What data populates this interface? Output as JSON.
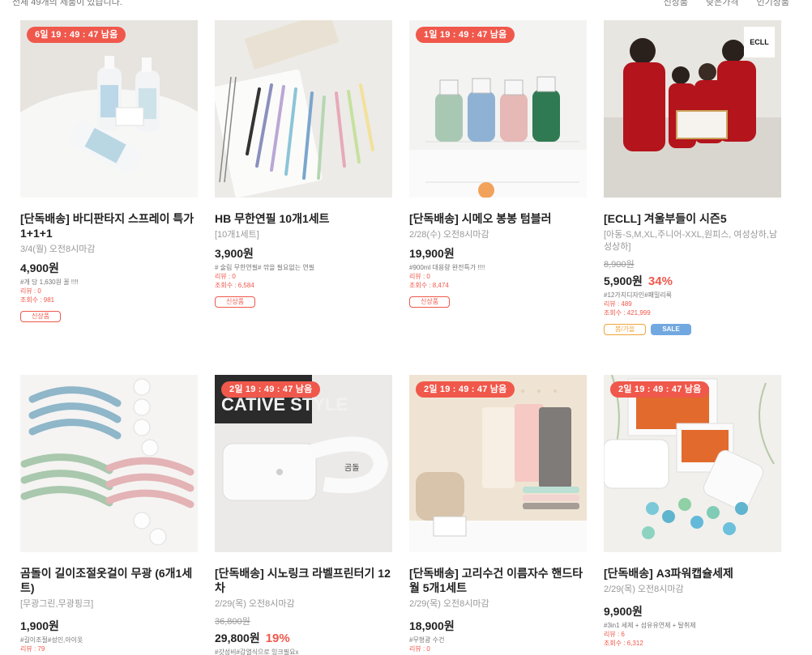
{
  "header": {
    "total_text": "전체 49개의 제품이 있습니다.",
    "sort_options": [
      "신상품",
      "낮은가격",
      "인기상품"
    ]
  },
  "products": [
    {
      "timer": "6일 19 : 49 : 47 남음",
      "title": "[단독배송] 바디판타지 스프레이 특가 1+1+1",
      "subtitle": "3/4(월) 오전8시마감",
      "original_price": "",
      "price": "4,900원",
      "discount": "",
      "note": "#개 당 1,630원 꼴 !!!!",
      "reviews": "리뷰 : 0",
      "views": "조회수 : 981",
      "badges": [
        {
          "label": "신상품",
          "style": "red"
        }
      ],
      "image_icon": "spray-bottles-image"
    },
    {
      "timer": "",
      "title": "HB 무한연필 10개1세트",
      "subtitle": "[10개1세트]",
      "original_price": "",
      "price": "3,900원",
      "discount": "",
      "note": "# 술림 무한연필# 깎을 필요없는 연필",
      "reviews": "리뷰 : 0",
      "views": "조회수 : 6,584",
      "badges": [
        {
          "label": "신상품",
          "style": "red"
        }
      ],
      "image_icon": "pencils-image"
    },
    {
      "timer": "1일 19 : 49 : 47 남음",
      "title": "[단독배송] 시메오 봉봉 텀블러",
      "subtitle": "2/28(수) 오전8시마감",
      "original_price": "",
      "price": "19,900원",
      "discount": "",
      "note": "#900ml 대용량 완전특가 !!!!",
      "reviews": "리뷰 : 0",
      "views": "조회수 : 8,474",
      "badges": [
        {
          "label": "신상품",
          "style": "red"
        }
      ],
      "image_icon": "tumblers-image"
    },
    {
      "timer": "",
      "brand_mark": "ECLL",
      "title": "[ECLL] 겨울부들이 시즌5",
      "subtitle": "[아동-S,M,XL,주니어-XXL,원피스, 여성상하,남성상하]",
      "original_price": "8,900원",
      "price": "5,900원",
      "discount": "34%",
      "note": "#12가지디자인#패밀리룩",
      "reviews": "리뷰 : 489",
      "views": "조회수 : 421,999",
      "badges": [
        {
          "label": "봄/가을",
          "style": "orange"
        },
        {
          "label": "SALE",
          "style": "blue"
        }
      ],
      "image_icon": "family-pajamas-image"
    },
    {
      "timer": "",
      "title": "곰돌이 길이조절옷걸이 무광 (6개1세트)",
      "subtitle": "[무광그린,무광핑크]",
      "original_price": "",
      "price": "1,900원",
      "discount": "",
      "note": "#길이조절#성인,아이옷",
      "reviews": "리뷰 : 79",
      "views": "",
      "badges": [],
      "image_icon": "hangers-image"
    },
    {
      "timer": "2일 19 : 49 : 47 남음",
      "title": "[단독배송] 시노링크 라벨프린터기 12차",
      "subtitle": "2/29(목) 오전8시마감",
      "original_price": "36,800원",
      "price": "29,800원",
      "discount": "19%",
      "note": "#갓성비#감열식으로 잉크필요x",
      "reviews": "",
      "views": "",
      "badges": [],
      "image_icon": "label-printer-image",
      "image_text": "CATIVE STYLE"
    },
    {
      "timer": "2일 19 : 49 : 47 남음",
      "title": "[단독배송] 고리수건 이름자수 핸드타월 5개1세트",
      "subtitle": "2/29(목) 오전8시마감",
      "original_price": "",
      "price": "18,900원",
      "discount": "",
      "note": "#무형광 수건",
      "reviews": "리뷰 : 0",
      "views": "",
      "badges": [],
      "image_icon": "hand-towels-image"
    },
    {
      "timer": "2일 19 : 49 : 47 남음",
      "title": "[단독배송] A3파워캡슐세제",
      "subtitle": "2/29(목) 오전8시마감",
      "original_price": "",
      "price": "9,900원",
      "discount": "",
      "note": "#3in1 세제 + 섬유유연제 + 탈취제",
      "reviews": "리뷰 : 6",
      "views": "조회수 : 6,312",
      "badges": [],
      "image_icon": "detergent-capsules-image"
    }
  ],
  "colors": {
    "accent": "#f0584c",
    "orange_badge": "#f0a33a",
    "blue_badge": "#72a8e0"
  }
}
